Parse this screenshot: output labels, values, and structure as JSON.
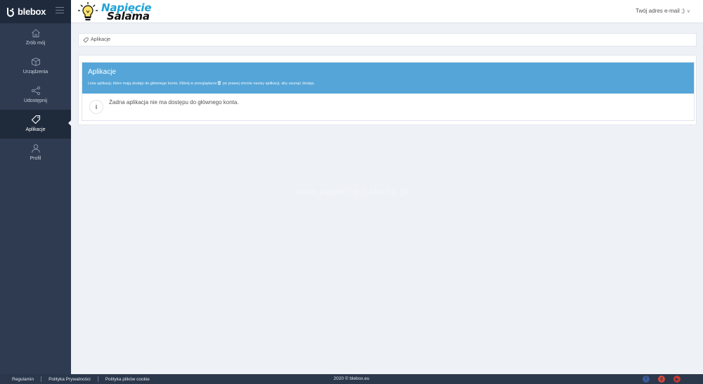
{
  "brand": {
    "name": "blebox"
  },
  "partner_logo": {
    "line1": "Napięcie",
    "line2": "Salama"
  },
  "user_menu": {
    "label": "Twój adres e-mail ;)"
  },
  "sidebar": {
    "items": [
      {
        "label": "Zrób mój",
        "icon": "home-icon"
      },
      {
        "label": "Urządzenia",
        "icon": "cube-icon"
      },
      {
        "label": "Udostępnij",
        "icon": "share-icon"
      },
      {
        "label": "Aplikacje",
        "icon": "tag-icon",
        "active": true
      },
      {
        "label": "Profil",
        "icon": "user-icon"
      }
    ]
  },
  "breadcrumb": {
    "label": "Aplikacje"
  },
  "panel": {
    "title": "Aplikacje",
    "description": "Lista aplikacji, które mają dostęp do głównego konta. Kliknij w przeglądarce🗑 po prawej stronie nazwy aplikacji, aby usunąć dostęp.",
    "empty_message": "Żadna aplikacja nie ma dostępu do głównego konta."
  },
  "watermark": "www.napiecie-salama.pl",
  "footer": {
    "links": [
      "Regulamin",
      "Polityka Prywatności",
      "Polityka plików cookie"
    ],
    "copyright": "2020 © blebox.eu"
  },
  "colors": {
    "sidebar": "#2e3b50",
    "panel_header": "#55a5d8",
    "background": "#eef1f6"
  }
}
